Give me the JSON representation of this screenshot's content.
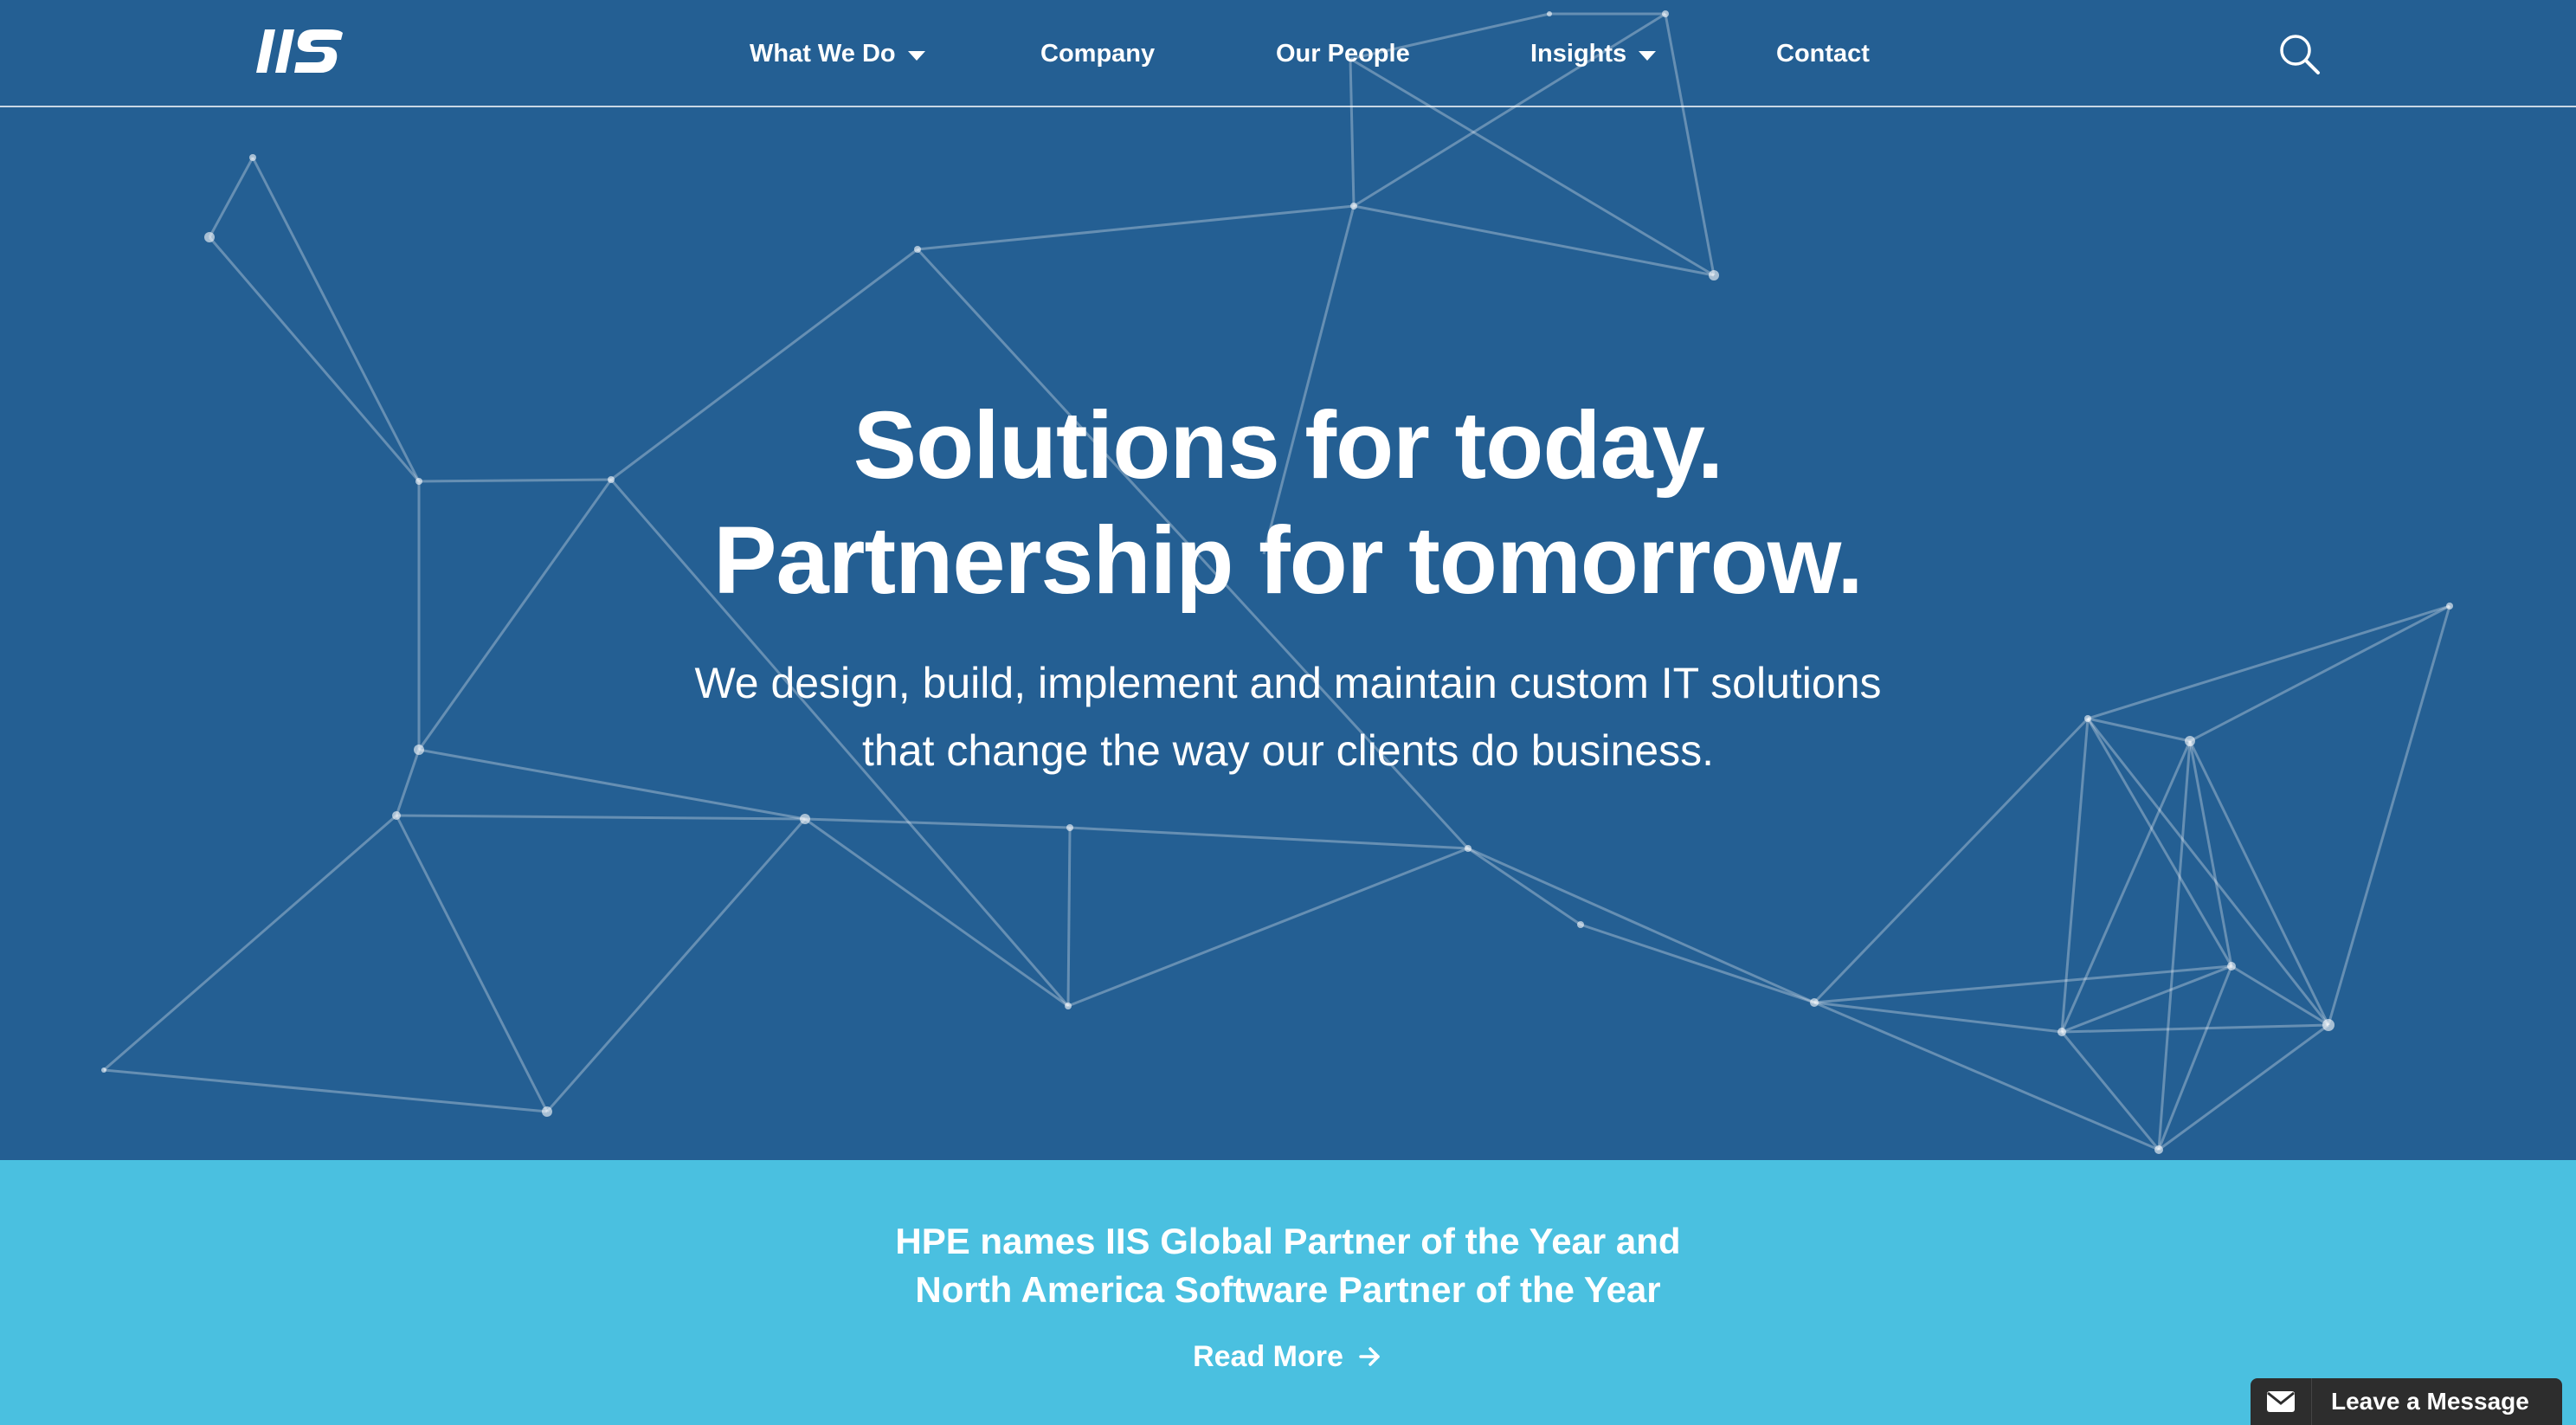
{
  "header": {
    "logo_text": "IIS",
    "nav": [
      {
        "label": "What We Do",
        "dropdown": true
      },
      {
        "label": "Company",
        "dropdown": false
      },
      {
        "label": "Our People",
        "dropdown": false
      },
      {
        "label": "Insights",
        "dropdown": true
      },
      {
        "label": "Contact",
        "dropdown": false
      }
    ],
    "search_icon": "search-icon"
  },
  "hero": {
    "headline_lines": [
      "Solutions for today.",
      "Partnership for tomorrow."
    ],
    "subtext_lines": [
      "We design, build, implement and maintain custom IT solutions",
      "that change the way our clients do business."
    ]
  },
  "banner": {
    "title_lines": [
      "HPE names IIS Global Partner of the Year and",
      "North America Software Partner of the Year"
    ],
    "read_more": "Read More",
    "read_more_icon": "arrow-right-icon"
  },
  "chat_widget": {
    "label": "Leave a Message",
    "icon": "envelope-icon"
  },
  "colors": {
    "hero_background": "#245f93",
    "banner_background": "#4ac0e0",
    "chat_background": "#2d2d2d",
    "text": "#ffffff"
  }
}
